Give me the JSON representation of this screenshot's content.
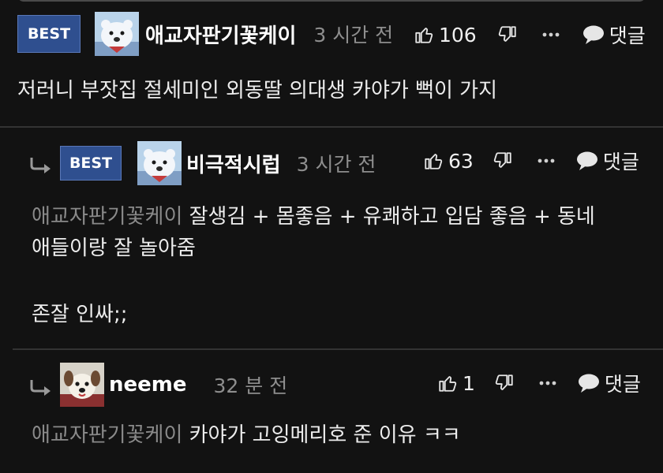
{
  "comments": [
    {
      "badge": "BEST",
      "nickname": "애교자판기꽃케이",
      "time": "3 시간 전",
      "likes": "106",
      "reply_label": "댓글",
      "text": "저러니 부잣집 절세미인 외동딸 의대생 카야가 뻑이 가지"
    },
    {
      "badge": "BEST",
      "nickname": "비극적시럽",
      "time": "3 시간 전",
      "likes": "63",
      "reply_label": "댓글",
      "mention": "애교자판기꽃케이",
      "text_line1": "잘생김 + 몸좋음 + 유쾌하고 입담 좋음 + 동네",
      "text_line2": "애들이랑 잘 놀아줌",
      "text_line3": "존잘 인싸;;"
    },
    {
      "nickname": "neeme",
      "time": "32 분 전",
      "likes": "1",
      "reply_label": "댓글",
      "mention": "애교자판기꽃케이",
      "text": "카야가 고잉메리호 준 이유 ㅋㅋ"
    }
  ],
  "icons": {
    "like": "thumbs-up-icon",
    "dislike": "thumbs-down-icon",
    "more": "more-dots-icon",
    "reply": "speech-bubble-icon",
    "reply_arrow": "reply-arrow-icon"
  },
  "colors": {
    "background": "#121212",
    "badge": "#2f4f8f",
    "text": "#ededed",
    "muted": "#8e8e8e"
  }
}
